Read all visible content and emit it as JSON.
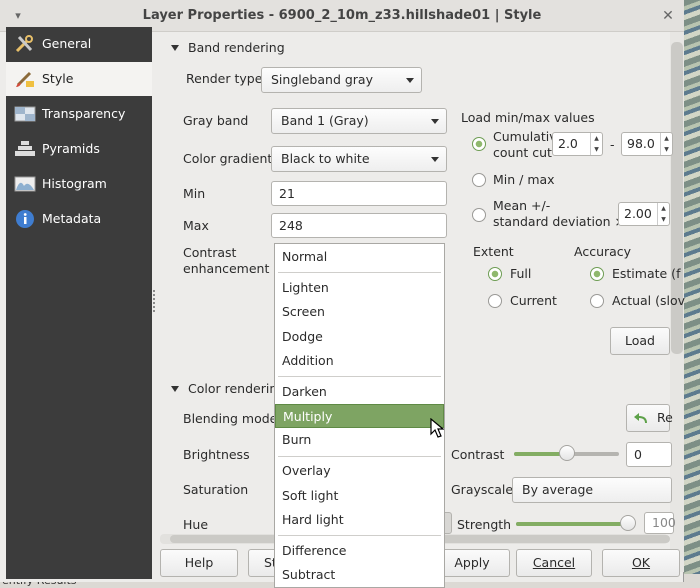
{
  "window": {
    "title": "Layer Properties - 6900_2_10m_z33.hillshade01 | Style"
  },
  "sidebar": {
    "items": [
      {
        "label": "General",
        "icon": "wrench-icon"
      },
      {
        "label": "Style",
        "icon": "paintbrush-icon"
      },
      {
        "label": "Transparency",
        "icon": "transparency-icon"
      },
      {
        "label": "Pyramids",
        "icon": "pyramids-icon"
      },
      {
        "label": "Histogram",
        "icon": "histogram-icon"
      },
      {
        "label": "Metadata",
        "icon": "info-icon"
      }
    ]
  },
  "band": {
    "section": "Band rendering",
    "render_type_label": "Render type",
    "render_type": "Singleband gray",
    "gray_band_label": "Gray band",
    "gray_band": "Band 1 (Gray)",
    "gradient_label": "Color gradient",
    "gradient": "Black to white",
    "min_label": "Min",
    "min": "21",
    "max_label": "Max",
    "max": "248",
    "contrast_label_1": "Contrast",
    "contrast_label_2": "enhancement"
  },
  "minmax": {
    "title": "Load min/max values",
    "cumulative_1": "Cumulativ",
    "cumulative_2": "count cut",
    "cut_low": "2.0",
    "dash": "-",
    "cut_high": "98.0",
    "minmax_option": "Min / max",
    "mean_1": "Mean +/-",
    "mean_2": "standard deviation ×",
    "stddev": "2.00",
    "extent_label": "Extent",
    "extent_full": "Full",
    "extent_current": "Current",
    "accuracy_label": "Accuracy",
    "accuracy_estimate": "Estimate (f",
    "accuracy_actual": "Actual (slov",
    "load_button": "Load"
  },
  "color": {
    "section": "Color rendering",
    "blending_label": "Blending mode",
    "brightness_label": "Brightness",
    "saturation_label": "Saturation",
    "hue_label": "Hue",
    "contrast_label": "Contrast",
    "contrast_value": "0",
    "contrast_level": 0.5,
    "grayscale_label": "Grayscale",
    "grayscale_value": "By average",
    "strength_label": "Strength",
    "strength_value": "100",
    "strength_level": 1.0,
    "reset_button": "Re"
  },
  "blend_menu": {
    "selected": "Multiply",
    "groups": [
      [
        "Normal"
      ],
      [
        "Lighten",
        "Screen",
        "Dodge",
        "Addition"
      ],
      [
        "Darken",
        "Multiply",
        "Burn"
      ],
      [
        "Overlay",
        "Soft light",
        "Hard light"
      ],
      [
        "Difference",
        "Subtract"
      ]
    ]
  },
  "footer": {
    "help": "Help",
    "style_partial": "St",
    "apply": "Apply",
    "cancel": "Cancel",
    "ok": "OK"
  },
  "background": {
    "results_label": "entify Results"
  },
  "colors": {
    "accent": "#7ea463",
    "sidebar": "#3c3c3c"
  }
}
